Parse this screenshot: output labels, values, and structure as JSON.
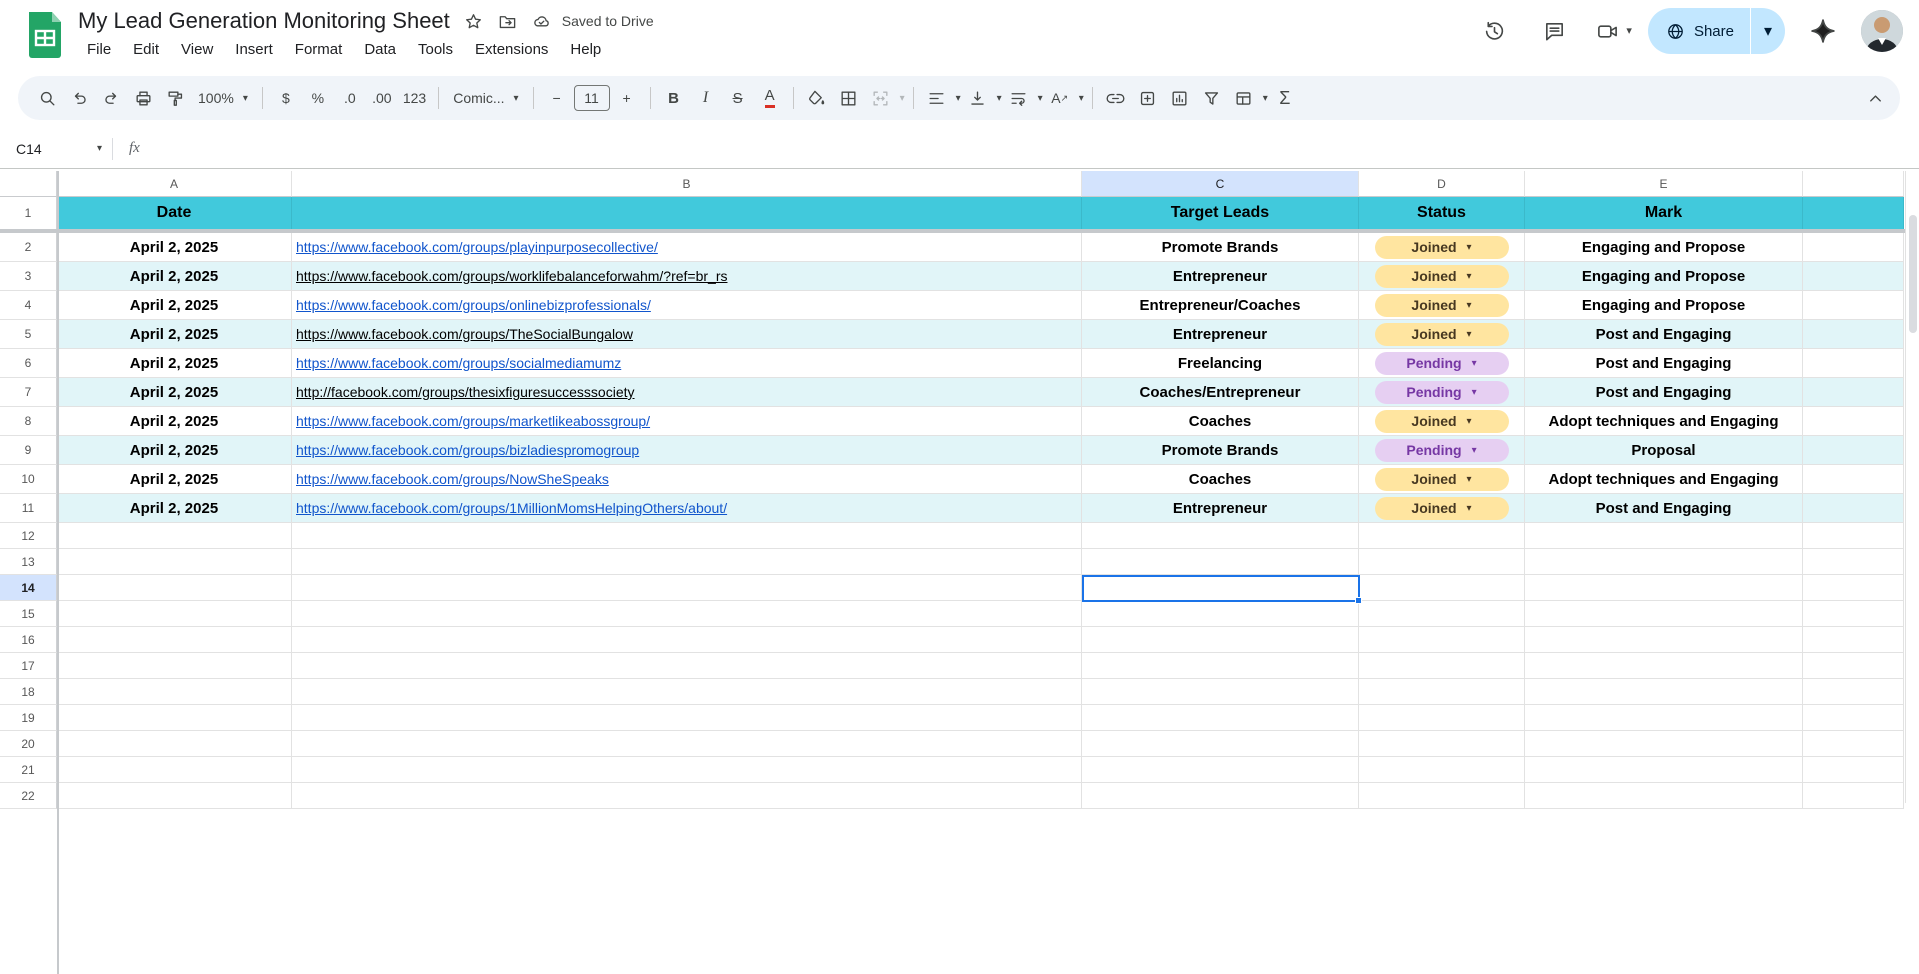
{
  "header": {
    "title": "My Lead Generation Monitoring Sheet",
    "saved_label": "Saved to Drive",
    "menu": [
      "File",
      "Edit",
      "View",
      "Insert",
      "Format",
      "Data",
      "Tools",
      "Extensions",
      "Help"
    ],
    "share_label": "Share"
  },
  "toolbar": {
    "zoom": "100%",
    "currency": "$",
    "percent": "%",
    "decrease_decimal": ".0",
    "increase_decimal": ".00",
    "more_formats": "123",
    "font": "Comic...",
    "font_size": "11",
    "minus": "−",
    "plus": "+",
    "bold": "B",
    "italic": "I",
    "strikethrough": "S",
    "text_color": "A",
    "text_rotation": "A",
    "functions": "Σ"
  },
  "formula_bar": {
    "cell_ref": "C14",
    "fx_label": "fx"
  },
  "grid": {
    "col_letters": [
      "A",
      "B",
      "C",
      "D",
      "E",
      ""
    ],
    "header_row_num": "1",
    "headers": {
      "date": "Date",
      "url": "",
      "target": "Target Leads",
      "status": "Status",
      "mark": "Mark"
    },
    "rows": [
      {
        "num": "2",
        "date": "April 2, 2025",
        "url": "https://www.facebook.com/groups/playinpurposecollective/",
        "url_style": "blue",
        "target": "Promote Brands",
        "status": "Joined",
        "status_style": "joined",
        "mark": "Engaging and Propose"
      },
      {
        "num": "3",
        "date": "April 2, 2025",
        "url": "https://www.facebook.com/groups/worklifebalanceforwahm/?ref=br_rs",
        "url_style": "black",
        "target": "Entrepreneur",
        "status": "Joined",
        "status_style": "joined",
        "mark": "Engaging and Propose"
      },
      {
        "num": "4",
        "date": "April 2, 2025",
        "url": "https://www.facebook.com/groups/onlinebizprofessionals/",
        "url_style": "blue",
        "target": "Entrepreneur/Coaches",
        "status": "Joined",
        "status_style": "joined",
        "mark": "Engaging and Propose"
      },
      {
        "num": "5",
        "date": "April 2, 2025",
        "url": "https://www.facebook.com/groups/TheSocialBungalow",
        "url_style": "black",
        "target": "Entrepreneur",
        "status": "Joined",
        "status_style": "joined",
        "mark": "Post and Engaging"
      },
      {
        "num": "6",
        "date": "April 2, 2025",
        "url": "https://www.facebook.com/groups/socialmediamumz",
        "url_style": "blue",
        "target": "Freelancing",
        "status": "Pending",
        "status_style": "pending",
        "mark": "Post and Engaging"
      },
      {
        "num": "7",
        "date": "April 2, 2025",
        "url": "http://facebook.com/groups/thesixfiguresuccesssociety",
        "url_style": "black",
        "target": "Coaches/Entrepreneur",
        "status": "Pending",
        "status_style": "pending",
        "mark": "Post and Engaging"
      },
      {
        "num": "8",
        "date": "April 2, 2025",
        "url": "https://www.facebook.com/groups/marketlikeabossgroup/",
        "url_style": "blue",
        "target": "Coaches",
        "status": "Joined",
        "status_style": "joined",
        "mark": "Adopt techniques and Engaging"
      },
      {
        "num": "9",
        "date": "April 2, 2025",
        "url": "https://www.facebook.com/groups/bizladiespromogroup",
        "url_style": "blue",
        "target": "Promote Brands",
        "status": "Pending",
        "status_style": "pending",
        "mark": "Proposal"
      },
      {
        "num": "10",
        "date": "April 2, 2025",
        "url": "https://www.facebook.com/groups/NowSheSpeaks",
        "url_style": "blue",
        "target": "Coaches",
        "status": "Joined",
        "status_style": "joined",
        "mark": "Adopt techniques and Engaging"
      },
      {
        "num": "11",
        "date": "April 2, 2025",
        "url": "https://www.facebook.com/groups/1MillionMomsHelpingOthers/about/",
        "url_style": "blue",
        "target": "Entrepreneur",
        "status": "Joined",
        "status_style": "joined",
        "mark": "Post and Engaging"
      }
    ],
    "empty_row_nums": [
      "12",
      "13",
      "14",
      "15",
      "16",
      "17",
      "18",
      "19",
      "20",
      "21",
      "22"
    ],
    "selected_cell": "C14"
  },
  "colors": {
    "header_row_bg": "#41c9dc",
    "banding_bg": "#e1f5f8",
    "joined_chip_bg": "#ffe5a0",
    "joined_chip_text": "#473821",
    "pending_chip_bg": "#e6cff2",
    "pending_chip_text": "#7637a4",
    "link_blue": "#1155cc",
    "selection_blue": "#1a73e8",
    "header_highlight": "#d3e3fd",
    "share_button_bg": "#c2e7ff"
  }
}
